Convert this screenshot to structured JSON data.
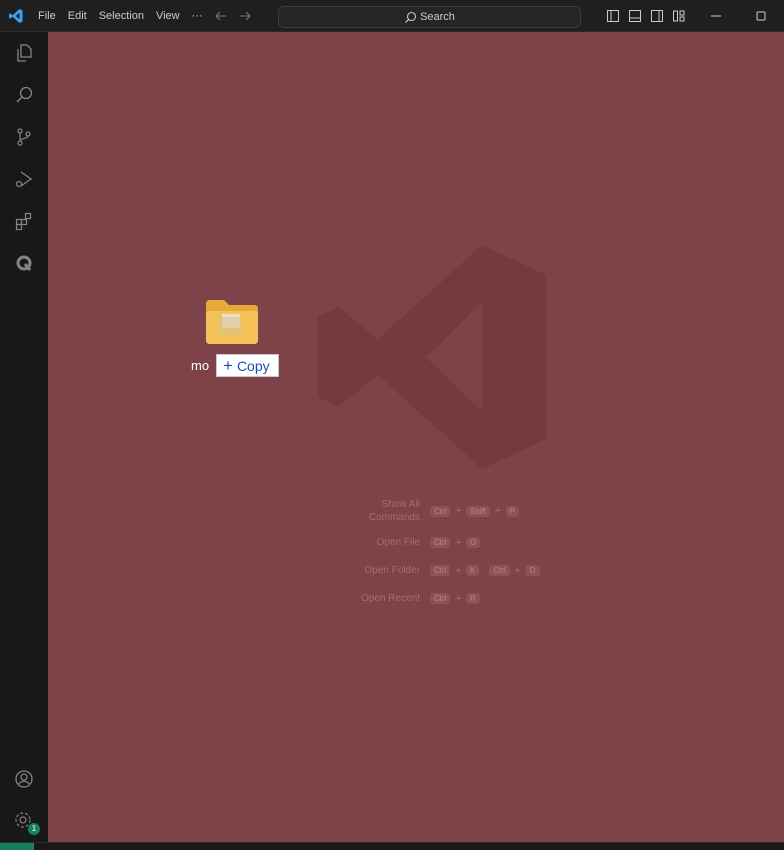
{
  "menu": {
    "items": [
      "File",
      "Edit",
      "Selection",
      "View",
      "···"
    ]
  },
  "search": {
    "label": "Search"
  },
  "drag": {
    "folder_label": "mo",
    "tooltip_label": "Copy",
    "tooltip_prefix": "+"
  },
  "shortcuts": [
    {
      "label_line1": "Show All",
      "label_line2": "Commands",
      "keys": [
        "Ctrl",
        "Shift",
        "P"
      ]
    },
    {
      "label": "Open File",
      "keys": [
        "Ctrl",
        "O"
      ]
    },
    {
      "label": "Open Folder",
      "chord1": [
        "Ctrl",
        "K"
      ],
      "chord2": [
        "Ctrl",
        "O"
      ]
    },
    {
      "label": "Open Recent",
      "keys": [
        "Ctrl",
        "R"
      ]
    }
  ],
  "activity": [
    "explorer-icon",
    "search-icon",
    "source-control-icon",
    "run-debug-icon",
    "extensions-icon",
    "extension-q-icon",
    "account-icon",
    "manage-gear-icon"
  ],
  "manage_badge": "1",
  "colors": {
    "editor_bg": "#7e4349",
    "titlebar_bg": "#1f1f1f",
    "activitybar_bg": "#181818",
    "accent": "#0078d4",
    "remote": "#16825d"
  }
}
